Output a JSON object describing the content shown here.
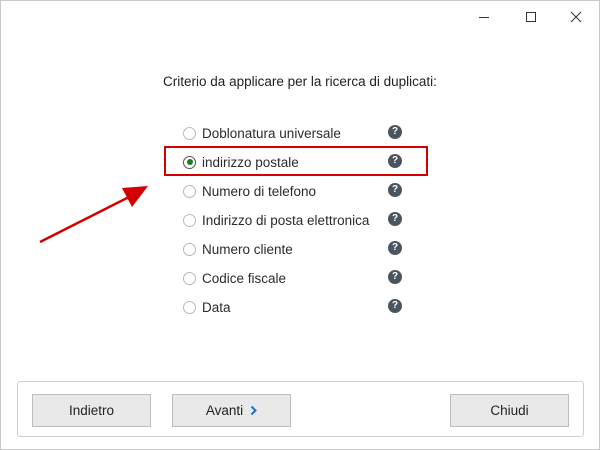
{
  "window": {
    "minimize_icon": "minimize-icon",
    "maximize_icon": "maximize-icon",
    "close_icon": "close-icon"
  },
  "prompt": "Criterio da applicare per la ricerca di duplicati:",
  "options": [
    {
      "label": "Doblonatura universale",
      "selected": false,
      "help_icon": "help-icon"
    },
    {
      "label": "indirizzo postale",
      "selected": true,
      "help_icon": "help-icon"
    },
    {
      "label": "Numero di telefono",
      "selected": false,
      "help_icon": "help-icon"
    },
    {
      "label": "Indirizzo di posta elettronica",
      "selected": false,
      "help_icon": "help-icon"
    },
    {
      "label": "Numero cliente",
      "selected": false,
      "help_icon": "help-icon"
    },
    {
      "label": "Codice fiscale",
      "selected": false,
      "help_icon": "help-icon"
    },
    {
      "label": "Data",
      "selected": false,
      "help_icon": "help-icon"
    }
  ],
  "help_glyph": "?",
  "buttons": {
    "back": "Indietro",
    "next": "Avanti",
    "close": "Chiudi"
  },
  "colors": {
    "annotation": "#d40000",
    "radio_selected": "#1f7a1f",
    "chevron": "#1a73c8"
  }
}
